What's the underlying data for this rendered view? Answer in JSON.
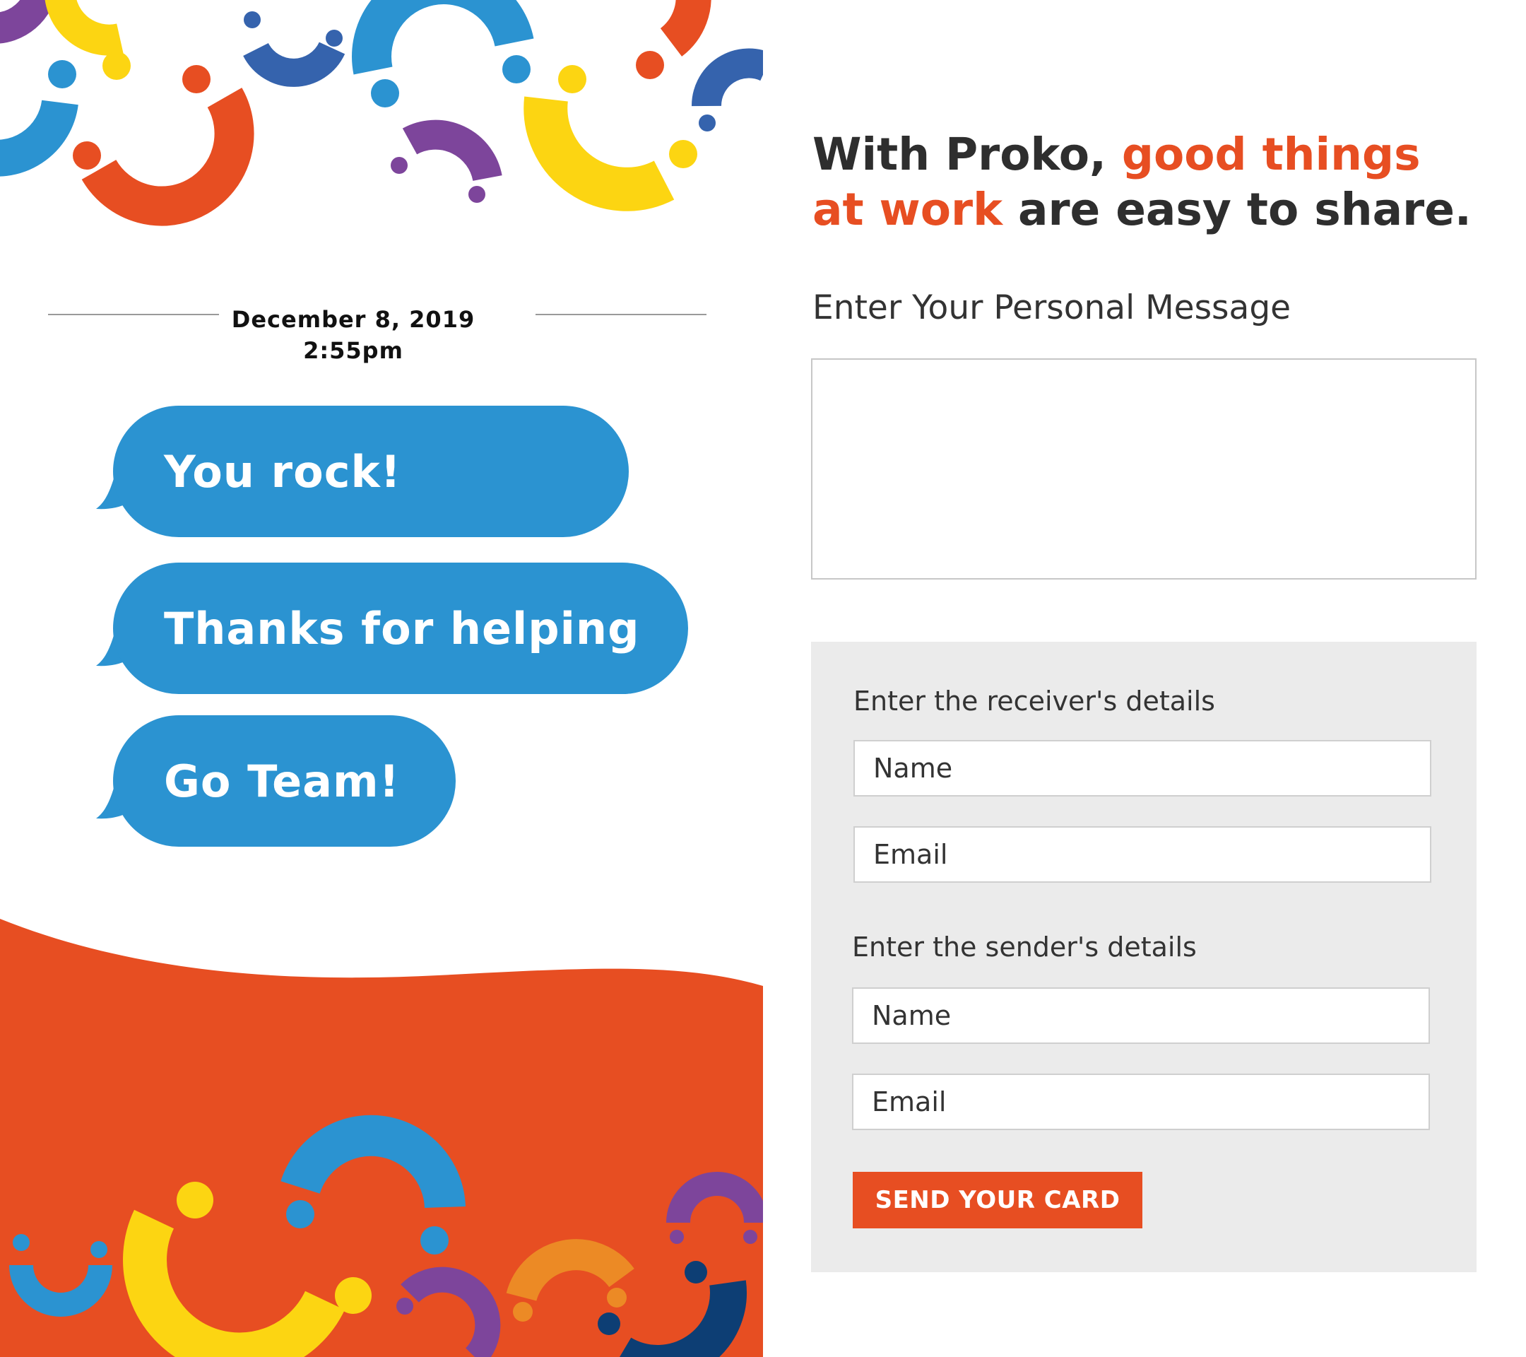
{
  "card": {
    "date": "December 8, 2019",
    "time": "2:55pm",
    "messages": [
      "You rock!",
      "Thanks for helping",
      "Go Team!"
    ]
  },
  "headline": {
    "part1": "With Proko, ",
    "accent": "good things at work",
    "part2": " are easy to share."
  },
  "form": {
    "message_label": "Enter Your Personal Message",
    "message_value": "",
    "receiver_label": "Enter the receiver's details",
    "receiver_name_placeholder": "Name",
    "receiver_email_placeholder": "Email",
    "sender_label": "Enter the sender's details",
    "sender_name_placeholder": "Name",
    "sender_email_placeholder": "Email",
    "send_label": "SEND YOUR CARD"
  },
  "colors": {
    "accent_orange": "#e74e22",
    "bubble_blue": "#2b93d1",
    "panel_gray": "#ebebeb",
    "yellow": "#fcd512",
    "purple": "#7d459b",
    "navy": "#3563ad",
    "dark_navy": "#0d3e74",
    "light_orange": "#ec8a25"
  }
}
